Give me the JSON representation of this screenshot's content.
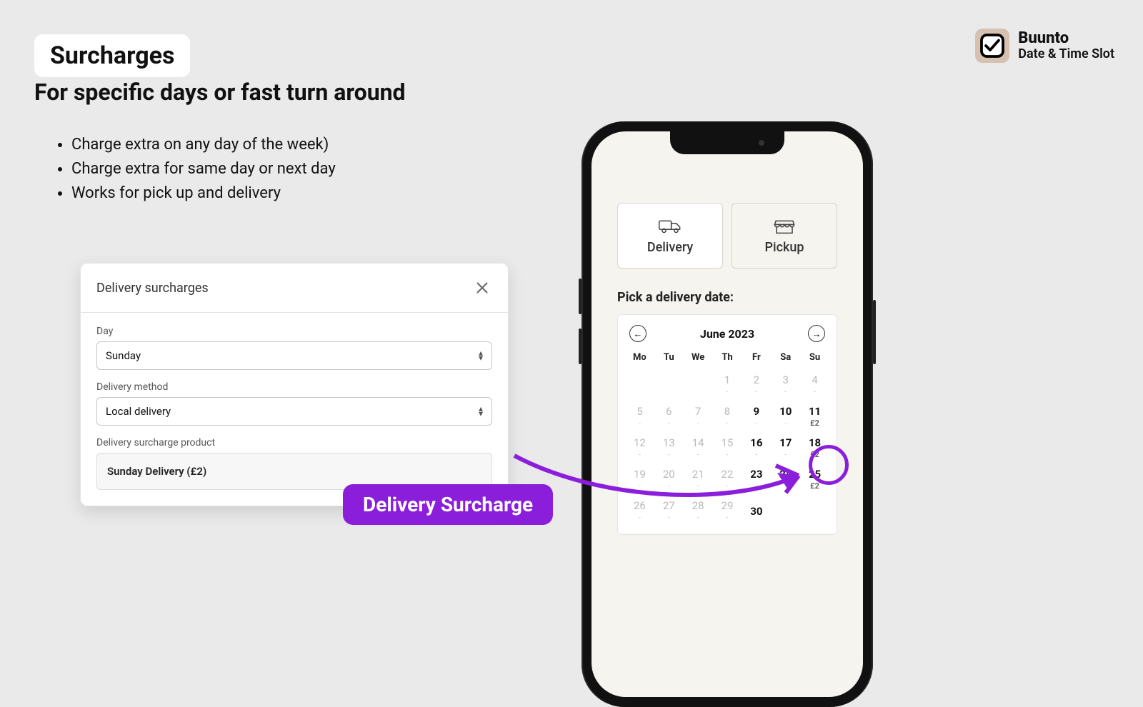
{
  "title": "Surcharges",
  "subtitle": "For specific days or fast turn around",
  "bullets": [
    "Charge extra on any day of the week)",
    "Charge extra for same day or next day",
    "Works for pick up and delivery"
  ],
  "brand": {
    "name": "Buunto",
    "sub": "Date & Time Slot"
  },
  "modal": {
    "title": "Delivery surcharges",
    "day_label": "Day",
    "day_value": "Sunday",
    "method_label": "Delivery method",
    "method_value": "Local delivery",
    "product_label": "Delivery surcharge product",
    "product_value": "Sunday Delivery (£2)"
  },
  "phone": {
    "tabs": {
      "delivery": "Delivery",
      "pickup": "Pickup"
    },
    "pick_label": "Pick a delivery date:",
    "cal_month": "June 2023",
    "dow": [
      "Mo",
      "Tu",
      "We",
      "Th",
      "Fr",
      "Sa",
      "Su"
    ],
    "days": [
      {
        "n": "",
        "s": ""
      },
      {
        "n": "",
        "s": ""
      },
      {
        "n": "",
        "s": ""
      },
      {
        "n": "1",
        "s": "-",
        "d": true
      },
      {
        "n": "2",
        "s": "-",
        "d": true
      },
      {
        "n": "3",
        "s": "-",
        "d": true
      },
      {
        "n": "4",
        "s": "-",
        "d": true
      },
      {
        "n": "5",
        "s": "-",
        "d": true
      },
      {
        "n": "6",
        "s": "-",
        "d": true
      },
      {
        "n": "7",
        "s": "-",
        "d": true
      },
      {
        "n": "8",
        "s": "-",
        "d": true
      },
      {
        "n": "9",
        "s": "-",
        "e": true
      },
      {
        "n": "10",
        "s": "-",
        "e": true
      },
      {
        "n": "11",
        "s": "£2",
        "e": true,
        "sc": true
      },
      {
        "n": "12",
        "s": "-",
        "d": true
      },
      {
        "n": "13",
        "s": "-",
        "d": true
      },
      {
        "n": "14",
        "s": "-",
        "d": true
      },
      {
        "n": "15",
        "s": "-",
        "d": true
      },
      {
        "n": "16",
        "s": "-",
        "e": true
      },
      {
        "n": "17",
        "s": "-",
        "e": true
      },
      {
        "n": "18",
        "s": "£2",
        "e": true,
        "sc": true
      },
      {
        "n": "19",
        "s": "-",
        "d": true
      },
      {
        "n": "20",
        "s": "-",
        "d": true
      },
      {
        "n": "21",
        "s": "-",
        "d": true
      },
      {
        "n": "22",
        "s": "-",
        "d": true
      },
      {
        "n": "23",
        "s": "-",
        "e": true
      },
      {
        "n": "24",
        "s": "-",
        "e": true
      },
      {
        "n": "25",
        "s": "£2",
        "e": true,
        "sc": true
      },
      {
        "n": "26",
        "s": "-",
        "d": true
      },
      {
        "n": "27",
        "s": "-",
        "d": true
      },
      {
        "n": "28",
        "s": "-",
        "d": true
      },
      {
        "n": "29",
        "s": "-",
        "d": true
      },
      {
        "n": "30",
        "s": "",
        "e": true
      },
      {
        "n": "",
        "s": ""
      },
      {
        "n": "",
        "s": ""
      }
    ]
  },
  "badge": "Delivery Surcharge"
}
